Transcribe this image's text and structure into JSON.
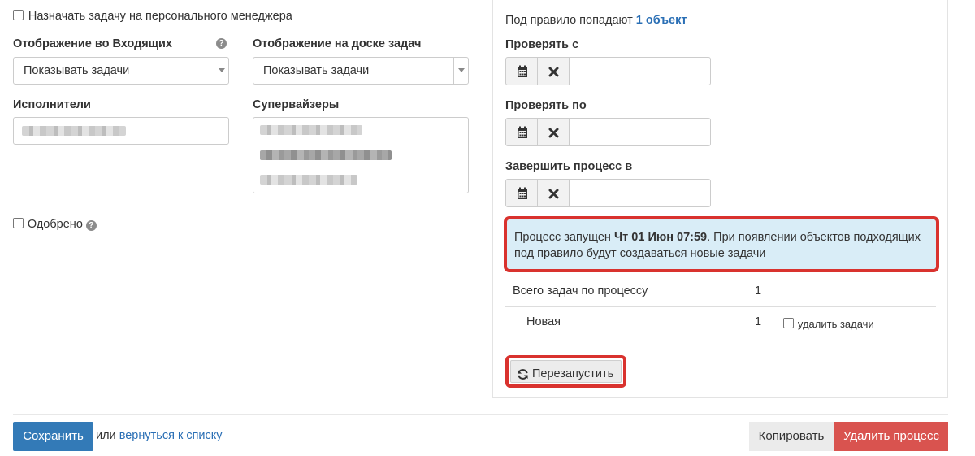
{
  "left": {
    "assign_manager_label": "Назначать задачу на персонального менеджера",
    "inbox_display": {
      "label": "Отображение во Входящих",
      "value": "Показывать задачи"
    },
    "board_display": {
      "label": "Отображение на доске задач",
      "value": "Показывать задачи"
    },
    "executors_label": "Исполнители",
    "supervisors_label": "Супервайзеры",
    "approved_label": "Одобрено"
  },
  "right": {
    "rule_prefix": "Под правило попадают ",
    "rule_link": "1 объект",
    "check_from_label": "Проверять с",
    "check_to_label": "Проверять по",
    "finish_label": "Завершить процесс в",
    "alert": {
      "before": "Процесс запущен ",
      "date": "Чт 01 Июн 07:59",
      "after": ". При появлении объектов подходящих под правило будут создаваться новые задачи"
    },
    "stats": {
      "total_label": "Всего задач по процессу",
      "total_value": "1",
      "new_label": "Новая",
      "new_value": "1",
      "delete_label": "удалить задачи"
    },
    "restart_label": "Перезапустить"
  },
  "footer": {
    "save_label": "Сохранить",
    "or_text": "или",
    "back_link": "вернуться к списку",
    "copy_label": "Копировать",
    "delete_label": "Удалить процесс"
  },
  "colors": {
    "primary": "#337ab7",
    "danger": "#d9534f",
    "highlight": "#d9322e",
    "info_bg": "#d9edf7",
    "link": "#2a6fb5"
  },
  "icons": [
    "calendar-icon",
    "clear-icon",
    "help-icon",
    "refresh-icon",
    "dropdown-arrow-icon"
  ]
}
